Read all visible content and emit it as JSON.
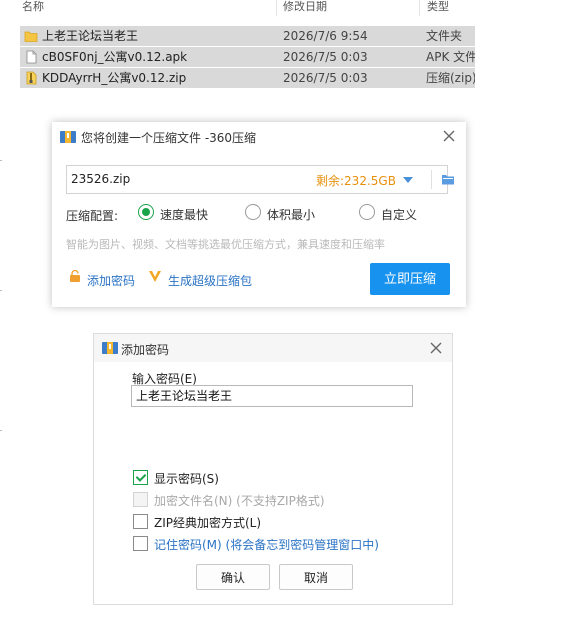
{
  "explorer": {
    "columns": {
      "name": "名称",
      "modified": "修改日期",
      "type": "类型"
    },
    "files": [
      {
        "name": "上老王论坛当老王",
        "date": "2026/7/6 9:54",
        "type": "文件夹",
        "icon": "folder-icon"
      },
      {
        "name": "cB0SF0nj_公寓v0.12.apk",
        "date": "2026/7/5 0:03",
        "type": "APK 文件",
        "icon": "apk-file-icon"
      },
      {
        "name": "KDDAyrrH_公寓v0.12.zip",
        "date": "2026/7/5 0:03",
        "type": "压缩(zip)",
        "icon": "zip-file-icon"
      }
    ]
  },
  "compress_dialog": {
    "title": "您将创建一个压缩文件 -360压缩",
    "filename": "23526.zip",
    "remaining": "剩余:232.5GB",
    "config_label": "压缩配置:",
    "options": [
      "速度最快",
      "体积最小",
      "自定义"
    ],
    "selected_option": "速度最快",
    "hint": "智能为图片、视频、文档等挑选最优压缩方式，兼具速度和压缩率",
    "add_password_link": "添加密码",
    "super_package_link": "生成超级压缩包",
    "compress_button": "立即压缩",
    "accent_color": "#1792ee",
    "remaining_color": "#e8900c"
  },
  "password_dialog": {
    "title": "添加密码",
    "password_label": "输入密码(E)",
    "password_value": "上老王论坛当老王",
    "show_password": "显示密码(S)",
    "encrypt_filenames": "加密文件名(N) (不支持ZIP格式)",
    "zip_classic": "ZIP经典加密方式(L)",
    "remember_password": "记住密码(M) (将会备忘到密码管理窗口中)",
    "ok_button": "确认",
    "cancel_button": "取消"
  }
}
